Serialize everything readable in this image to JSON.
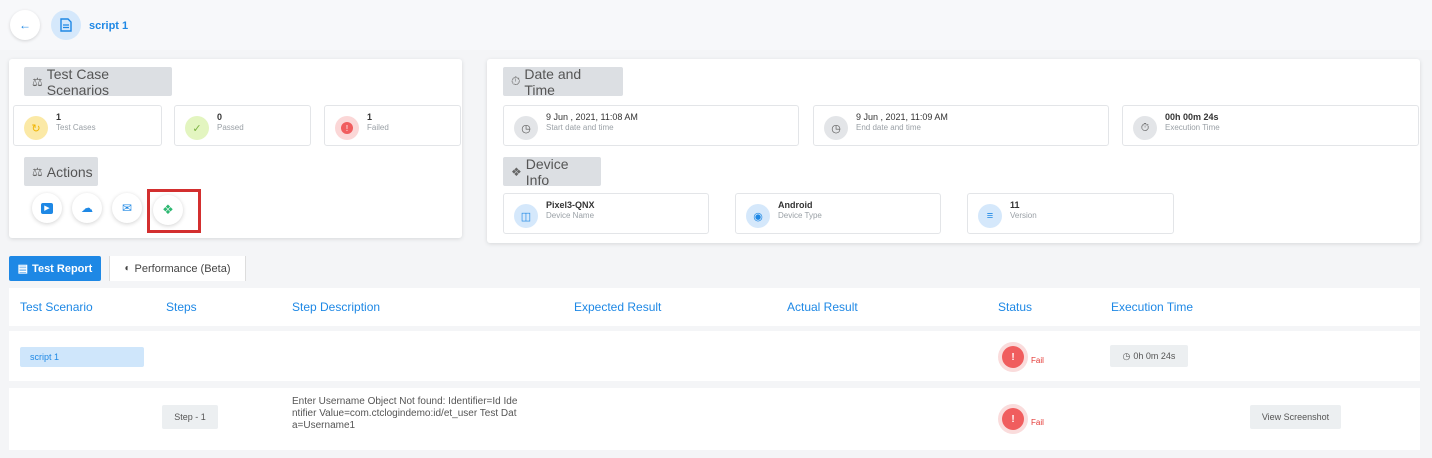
{
  "header": {
    "back_icon": "arrow-left-icon",
    "doc_icon": "document-icon",
    "script_name": "script 1"
  },
  "scenarios": {
    "title": "Test Case Scenarios",
    "stats": [
      {
        "value": "1",
        "label": "Test Cases",
        "icon": "cycle-icon",
        "color": "#fbe9a6"
      },
      {
        "value": "0",
        "label": "Passed",
        "icon": "check-double-icon",
        "color": "#e3f5c0"
      },
      {
        "value": "1",
        "label": "Failed",
        "icon": "error-icon",
        "color": "#fbd7d7"
      }
    ]
  },
  "actions": {
    "title": "Actions",
    "buttons": [
      "video-play-icon",
      "cloud-upload-icon",
      "mail-icon",
      "jira-icon"
    ]
  },
  "datetime": {
    "title": "Date and Time",
    "items": [
      {
        "value": "9 Jun , 2021, 11:08 AM",
        "label": "Start date and time",
        "icon": "clock-icon"
      },
      {
        "value": "9 Jun , 2021, 11:09 AM",
        "label": "End date and time",
        "icon": "clock-icon"
      },
      {
        "value": "00h 00m 24s",
        "label": "Execution Time",
        "icon": "stopwatch-icon"
      }
    ]
  },
  "device": {
    "title": "Device Info",
    "items": [
      {
        "value": "Pixel3-QNX",
        "label": "Device Name",
        "icon": "device-icon"
      },
      {
        "value": "Android",
        "label": "Device Type",
        "icon": "android-icon"
      },
      {
        "value": "11",
        "label": "Version",
        "icon": "version-icon"
      }
    ]
  },
  "tabs": {
    "report": "Test Report",
    "performance": "Performance (Beta)"
  },
  "table": {
    "columns": [
      "Test Scenario",
      "Steps",
      "Step Description",
      "Expected Result",
      "Actual Result",
      "Status",
      "Execution Time"
    ],
    "scenario_row": {
      "scenario": "script 1",
      "status": "Fail",
      "time": "0h 0m 24s"
    },
    "step_row": {
      "step": "Step - 1",
      "description_lines": [
        "Enter Username Object Not found: Identifier=Id Ide",
        "ntifier Value=com.ctclogindemo:id/et_user Test Dat",
        "a=Username1"
      ],
      "status": "Fail",
      "action": "View Screenshot"
    }
  },
  "colors": {
    "accent": "#1e88e5",
    "fail": "#e53935",
    "highlight_border": "#d32f2f"
  }
}
